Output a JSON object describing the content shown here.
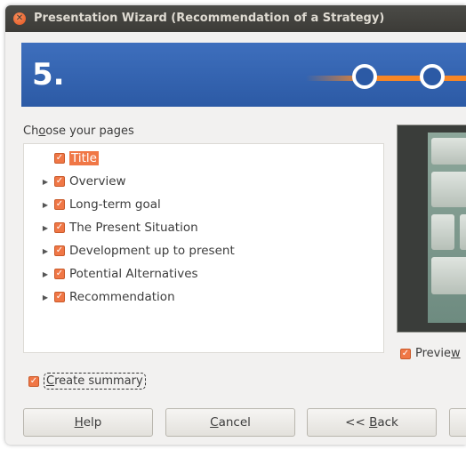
{
  "window": {
    "title": "Presentation Wizard (Recommendation of a Strategy)"
  },
  "banner": {
    "step": "5."
  },
  "pages": {
    "label_pre": "Ch",
    "label_key": "o",
    "label_post": "ose your pages",
    "items": [
      {
        "label": "Title",
        "checked": true,
        "selected": true,
        "expandable": false
      },
      {
        "label": "Overview",
        "checked": true,
        "selected": false,
        "expandable": true
      },
      {
        "label": "Long-term goal",
        "checked": true,
        "selected": false,
        "expandable": true
      },
      {
        "label": "The Present Situation",
        "checked": true,
        "selected": false,
        "expandable": true
      },
      {
        "label": "Development up to present",
        "checked": true,
        "selected": false,
        "expandable": true
      },
      {
        "label": "Potential Alternatives",
        "checked": true,
        "selected": false,
        "expandable": true
      },
      {
        "label": "Recommendation",
        "checked": true,
        "selected": false,
        "expandable": true
      }
    ]
  },
  "preview": {
    "label_pre": "Previe",
    "label_key": "w",
    "checked": true
  },
  "summary": {
    "label_key": "C",
    "label_post": "reate summary",
    "checked": true
  },
  "buttons": {
    "help_key": "H",
    "help_post": "elp",
    "cancel_key": "C",
    "cancel_post": "ancel",
    "back_pre": "<< ",
    "back_key": "B",
    "back_post": "ack"
  },
  "colors": {
    "accent": "#f07746",
    "banner": "#2c5aa5",
    "titlebar": "#3c3b37"
  }
}
